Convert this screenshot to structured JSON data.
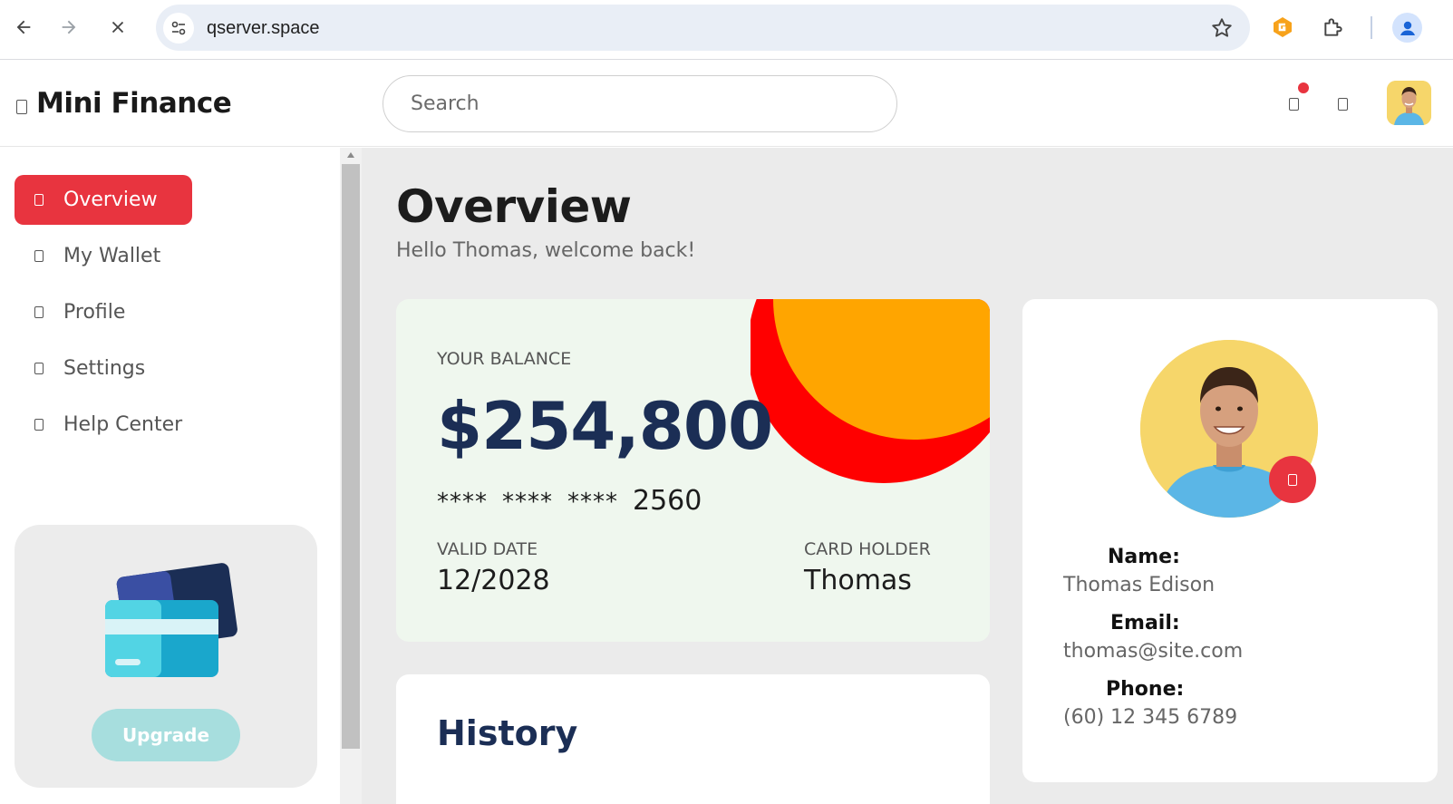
{
  "browser": {
    "url": "qserver.space"
  },
  "app": {
    "brand": "Mini Finance",
    "search_placeholder": "Search"
  },
  "sidebar": {
    "items": [
      {
        "label": "Overview",
        "active": true
      },
      {
        "label": "My Wallet",
        "active": false
      },
      {
        "label": "Profile",
        "active": false
      },
      {
        "label": "Settings",
        "active": false
      },
      {
        "label": "Help Center",
        "active": false
      }
    ],
    "promo": {
      "button_label": "Upgrade"
    }
  },
  "main": {
    "title": "Overview",
    "subtitle": "Hello Thomas, welcome back!",
    "balance_card": {
      "label": "YOUR BALANCE",
      "amount": "$254,800",
      "masked_groups": [
        "****",
        "****",
        "****"
      ],
      "last_four": "2560",
      "valid_label": "VALID DATE",
      "valid_value": "12/2028",
      "holder_label": "CARD HOLDER",
      "holder_value": "Thomas"
    },
    "history": {
      "title": "History"
    },
    "profile": {
      "name_label": "Name:",
      "name_value": "Thomas Edison",
      "email_label": "Email:",
      "email_value": "thomas@site.com",
      "phone_label": "Phone:",
      "phone_value": "(60) 12 345 6789"
    }
  },
  "colors": {
    "accent": "#e8343f",
    "navy": "#1b2e55",
    "orange": "#ffa500",
    "red": "#ff0000",
    "card_bg": "#eff7ee",
    "upgrade_bg": "#a7dede"
  }
}
